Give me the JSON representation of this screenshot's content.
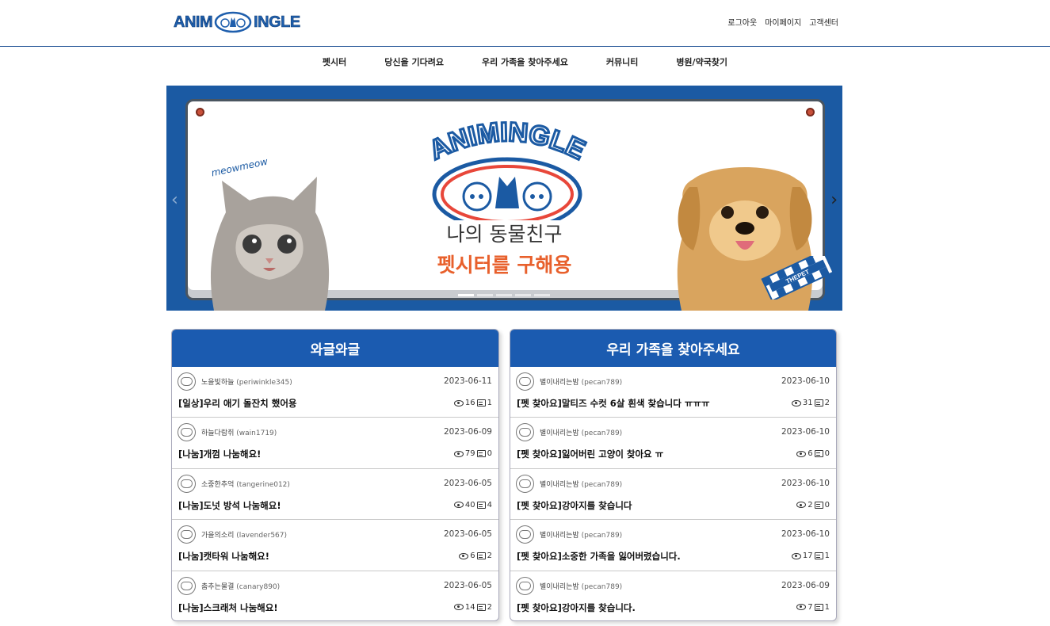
{
  "header": {
    "logo_left": "ANIM",
    "logo_right": "INGLE",
    "links": [
      "로그아웃",
      "마이페이지",
      "고객센터"
    ]
  },
  "nav": [
    "펫시터",
    "당신을 기다려요",
    "우리 가족을 찾아주세요",
    "커뮤니티",
    "병원/약국찾기"
  ],
  "banner": {
    "logo_text": "ANIMINGLE",
    "meow": "meowmeow",
    "line1": "나의 동물친구",
    "line2": "펫시터를 구해용",
    "badge": "THEPET",
    "prev": "‹",
    "next": "›",
    "slide_count": 5,
    "active_slide": 0
  },
  "panels": {
    "left": {
      "title": "와글와글",
      "posts": [
        {
          "nick": "노을빛하늘",
          "uid": "(periwinkle345)",
          "date": "2023-06-11",
          "title": "[일상]우리 애기 돌잔치 했어용",
          "views": "16",
          "comments": "1"
        },
        {
          "nick": "하늘다람쥐",
          "uid": "(wain1719)",
          "date": "2023-06-09",
          "title": "[나눔]개껌 나눔해요!",
          "views": "79",
          "comments": "0"
        },
        {
          "nick": "소중한추억",
          "uid": "(tangerine012)",
          "date": "2023-06-05",
          "title": "[나눔]도넛 방석 나눔해요!",
          "views": "40",
          "comments": "4"
        },
        {
          "nick": "가을의소리",
          "uid": "(lavender567)",
          "date": "2023-06-05",
          "title": "[나눔]캣타워 나눔해요!",
          "views": "6",
          "comments": "2"
        },
        {
          "nick": "춤추는물결",
          "uid": "(canary890)",
          "date": "2023-06-05",
          "title": "[나눔]스크래처 나눔해요!",
          "views": "14",
          "comments": "2"
        }
      ]
    },
    "right": {
      "title": "우리 가족을 찾아주세요",
      "posts": [
        {
          "nick": "별이내리는밤",
          "uid": "(pecan789)",
          "date": "2023-06-10",
          "title": "[펫 찾아요]말티즈 수컷 6살 흰색 찾습니다 ㅠㅠㅠ",
          "views": "31",
          "comments": "2"
        },
        {
          "nick": "별이내리는밤",
          "uid": "(pecan789)",
          "date": "2023-06-10",
          "title": "[펫 찾아요]잃어버린 고양이 찾아요 ㅠ",
          "views": "6",
          "comments": "0"
        },
        {
          "nick": "별이내리는밤",
          "uid": "(pecan789)",
          "date": "2023-06-10",
          "title": "[펫 찾아요]강아지를 찾습니다",
          "views": "2",
          "comments": "0"
        },
        {
          "nick": "별이내리는밤",
          "uid": "(pecan789)",
          "date": "2023-06-10",
          "title": "[펫 찾아요]소중한 가족을 잃어버렸습니다.",
          "views": "17",
          "comments": "1"
        },
        {
          "nick": "별이내리는밤",
          "uid": "(pecan789)",
          "date": "2023-06-09",
          "title": "[펫 찾아요]강아지를 찾습니다.",
          "views": "7",
          "comments": "1"
        }
      ]
    }
  }
}
